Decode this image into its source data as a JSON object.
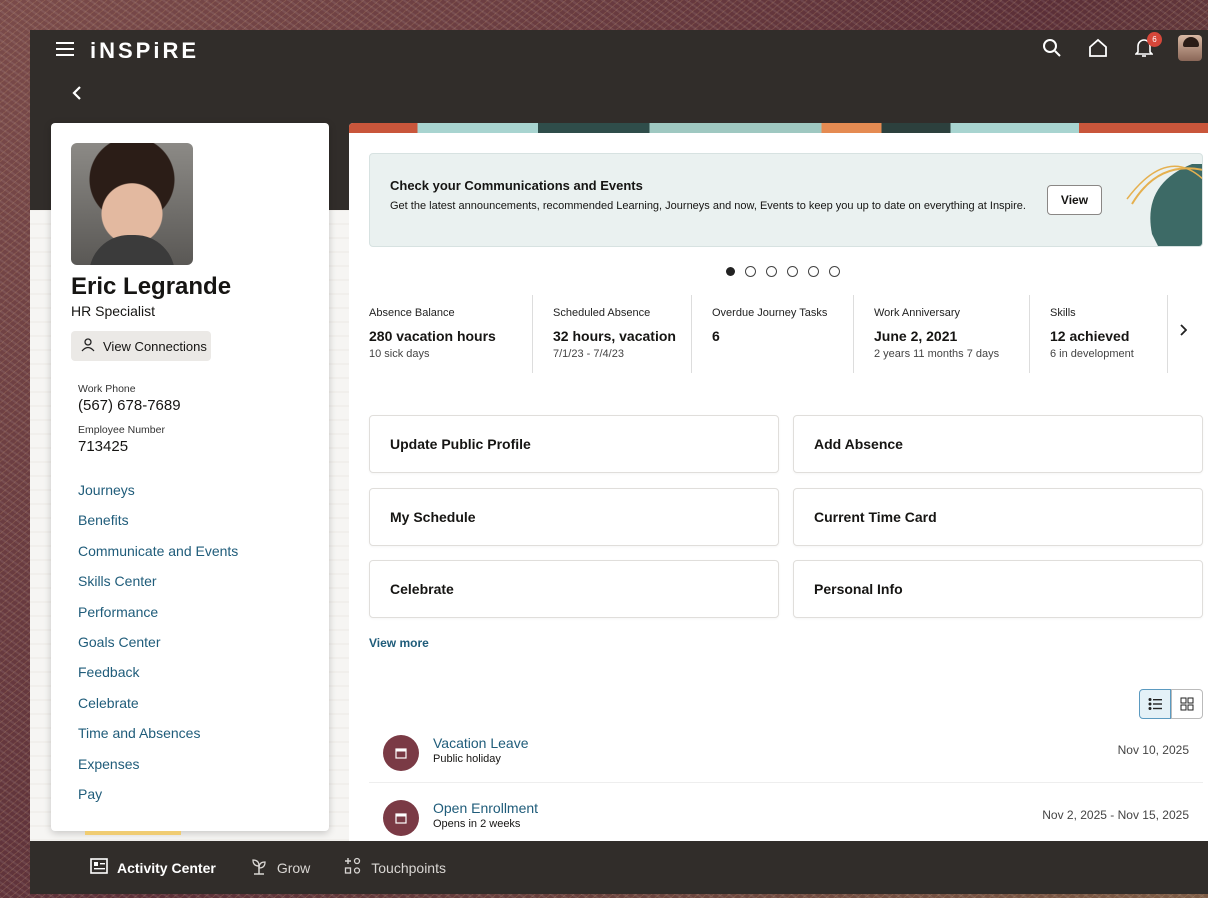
{
  "header": {
    "brand": "iNSPiRE",
    "notification_count": "6"
  },
  "profile": {
    "name": "Eric Legrande",
    "role": "HR Specialist",
    "connections_label": "View Connections",
    "work_phone_label": "Work Phone",
    "work_phone": "(567) 678-7689",
    "employee_number_label": "Employee Number",
    "employee_number": "713425",
    "nav": [
      "Journeys",
      "Benefits",
      "Communicate and Events",
      "Skills Center",
      "Performance",
      "Goals Center",
      "Feedback",
      "Celebrate",
      "Time and Absences",
      "Expenses",
      "Pay"
    ]
  },
  "announcement": {
    "title": "Check your Communications and Events",
    "text": "Get the latest announcements, recommended Learning, Journeys and now, Events to keep you up to date on everything at Inspire.",
    "button": "View"
  },
  "carousel": {
    "count": 6,
    "active_index": 0
  },
  "metrics": [
    {
      "label": "Absence Balance",
      "value": "280 vacation hours",
      "sub": "10 sick days"
    },
    {
      "label": "Scheduled Absence",
      "value": "32 hours, vacation",
      "sub": "7/1/23 - 7/4/23"
    },
    {
      "label": "Overdue Journey Tasks",
      "value": "6",
      "sub": ""
    },
    {
      "label": "Work Anniversary",
      "value": "June 2, 2021",
      "sub": "2 years 11 months 7 days"
    },
    {
      "label": "Skills",
      "value": "12 achieved",
      "sub": "6 in development"
    }
  ],
  "tiles": [
    "Update Public Profile",
    "Add Absence",
    "My Schedule",
    "Current Time Card",
    "Celebrate",
    "Personal Info"
  ],
  "view_more": "View more",
  "activities": [
    {
      "title": "Vacation Leave",
      "sub": "Public holiday",
      "date": "Nov 10, 2025"
    },
    {
      "title": "Open Enrollment",
      "sub": "Opens in 2 weeks",
      "date": "Nov 2, 2025 - Nov 15, 2025"
    }
  ],
  "bottom_nav": [
    {
      "label": "Activity Center",
      "icon": "activity-center-icon",
      "active": true
    },
    {
      "label": "Grow",
      "icon": "grow-icon",
      "active": false
    },
    {
      "label": "Touchpoints",
      "icon": "touchpoints-icon",
      "active": false
    }
  ],
  "colors": {
    "header_bg": "#312d2a",
    "link": "#1f5c7a",
    "activity_icon_bg": "#7a3a45",
    "active_tab_accent": "#f0cc71",
    "badge": "#d6473a"
  }
}
